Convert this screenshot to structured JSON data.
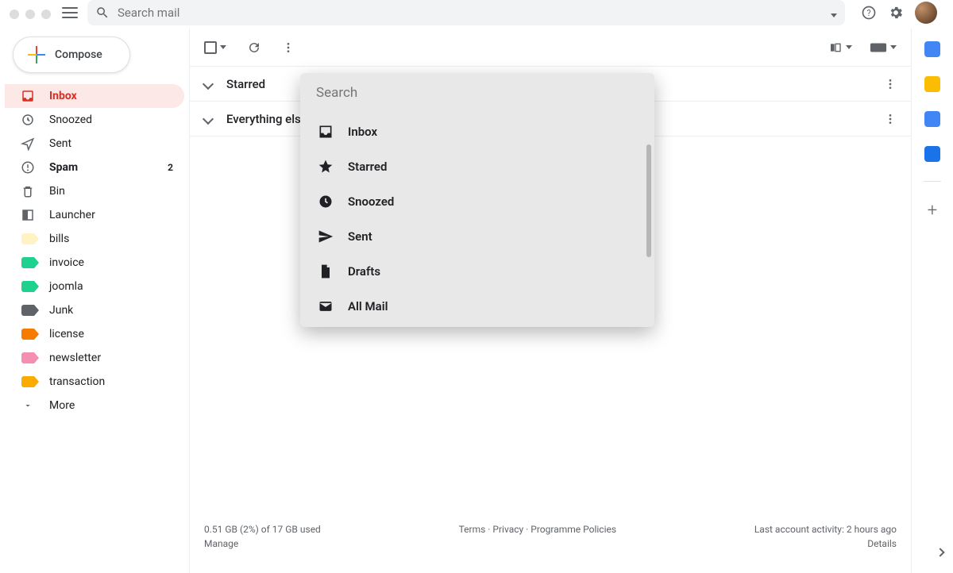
{
  "header": {
    "search_placeholder": "Search mail"
  },
  "compose_label": "Compose",
  "nav": [
    {
      "label": "Inbox",
      "icon": "inbox",
      "active": true
    },
    {
      "label": "Snoozed",
      "icon": "clock"
    },
    {
      "label": "Sent",
      "icon": "send"
    },
    {
      "label": "Spam",
      "icon": "spam",
      "bold": true,
      "count": "2"
    },
    {
      "label": "Bin",
      "icon": "trash"
    },
    {
      "label": "Launcher",
      "icon": "launcher"
    }
  ],
  "labels": [
    {
      "label": "bills",
      "color": "#fff3c4"
    },
    {
      "label": "invoice",
      "color": "#1fd18e"
    },
    {
      "label": "joomla",
      "color": "#1fd18e"
    },
    {
      "label": "Junk",
      "color": "#5f6368"
    },
    {
      "label": "license",
      "color": "#f57c00"
    },
    {
      "label": "newsletter",
      "color": "#f48fb1"
    },
    {
      "label": "transaction",
      "color": "#f9ab00"
    }
  ],
  "more_label": "More",
  "sections": [
    {
      "label": "Starred"
    },
    {
      "label": "Everything else"
    }
  ],
  "popover": {
    "search_placeholder": "Search",
    "items": [
      {
        "label": "Inbox",
        "icon": "inbox"
      },
      {
        "label": "Starred",
        "icon": "star"
      },
      {
        "label": "Snoozed",
        "icon": "clock-fill"
      },
      {
        "label": "Sent",
        "icon": "send-fill"
      },
      {
        "label": "Drafts",
        "icon": "file"
      },
      {
        "label": "All Mail",
        "icon": "mail"
      }
    ]
  },
  "footer": {
    "storage_line": "0.51 GB (2%) of 17 GB used",
    "manage": "Manage",
    "terms": "Terms",
    "privacy": "Privacy",
    "policies": "Programme Policies",
    "activity": "Last account activity: 2 hours ago",
    "details": "Details"
  }
}
